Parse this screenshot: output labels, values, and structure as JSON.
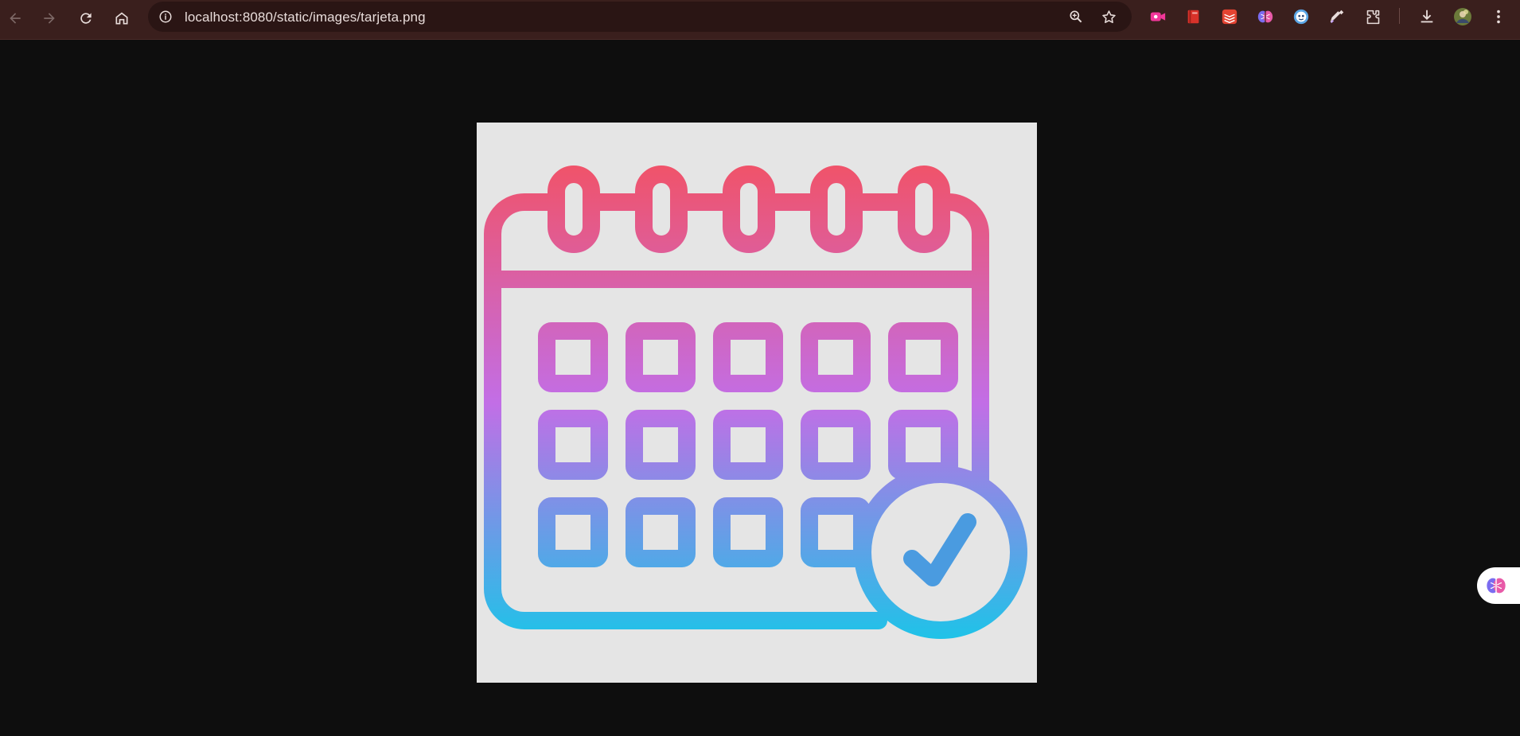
{
  "browser": {
    "url": "localhost:8080/static/images/tarjeta.png",
    "nav": {
      "back_icon": "arrow-left-icon",
      "forward_icon": "arrow-right-icon",
      "reload_icon": "reload-icon",
      "home_icon": "home-icon"
    },
    "omnibox_icons": [
      "site-info-icon",
      "zoom-icon",
      "bookmark-star-icon"
    ],
    "extensions": [
      "video-record-extension-icon",
      "book-extension-icon",
      "todoist-extension-icon",
      "brain-extension-icon",
      "bot-extension-icon",
      "eyedropper-extension-icon",
      "puzzle-extensions-icon"
    ],
    "right_icons": [
      "download-icon",
      "profile-avatar",
      "kebab-menu-icon"
    ]
  },
  "content": {
    "image_subject": "calendar-check-icon",
    "background_color": "#0e0e0e",
    "image_background": "#e5e5e5",
    "gradient_colors": [
      "#f0536a",
      "#c26ee6",
      "#1ec3e8"
    ]
  },
  "side_widget": {
    "icon": "brain-icon"
  }
}
